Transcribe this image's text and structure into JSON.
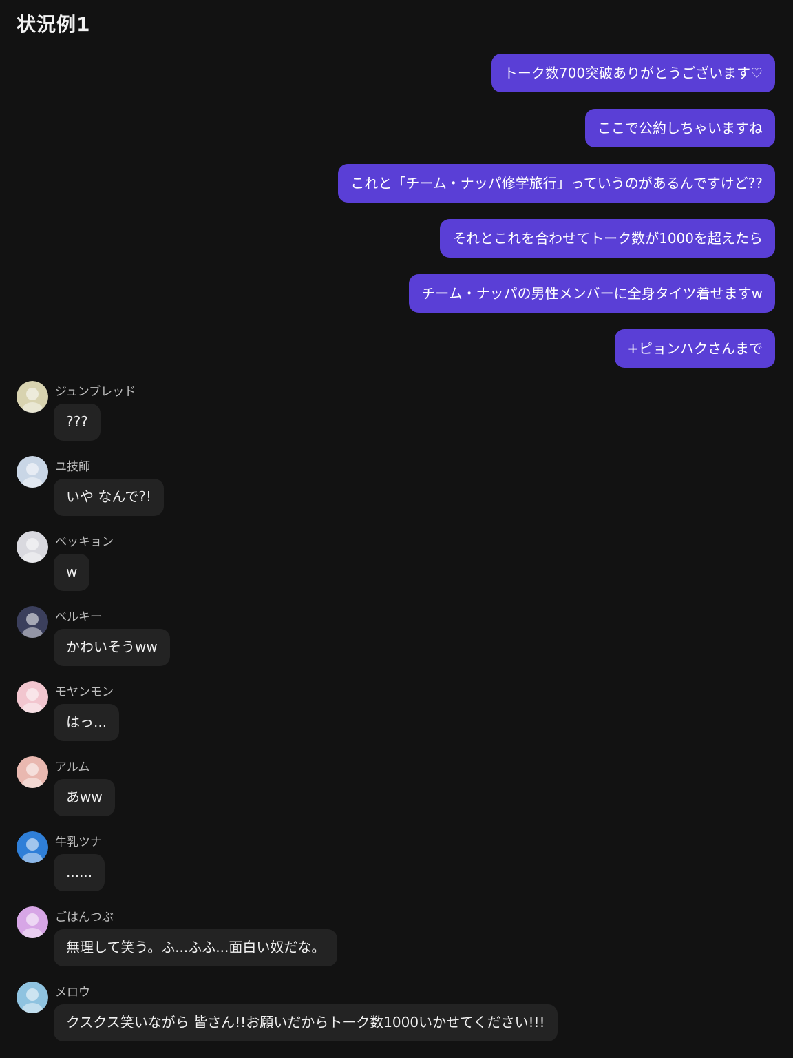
{
  "title": "状況例1",
  "colors": {
    "background": "#121212",
    "sent_bubble": "#5a3fd6",
    "received_bubble": "#232323"
  },
  "sent_messages": [
    "トーク数700突破ありがとうございます♡",
    "ここで公約しちゃいますね",
    "これと「チーム・ナッパ修学旅行」っていうのがあるんですけど??",
    "それとこれを合わせてトーク数が1000を超えたら",
    "チーム・ナッパの男性メンバーに全身タイツ着せますw",
    "+ピョンハクさんまで"
  ],
  "received_messages": [
    {
      "sender": "ジュンブレッド",
      "text": "???",
      "avatar_color": "#d8d3b0"
    },
    {
      "sender": "ユ技師",
      "text": "いや なんで?!",
      "avatar_color": "#c9d6e6"
    },
    {
      "sender": "ベッキョン",
      "text": "w",
      "avatar_color": "#d9d9df"
    },
    {
      "sender": "ベルキー",
      "text": "かわいそうww",
      "avatar_color": "#3b3f5c"
    },
    {
      "sender": "モヤンモン",
      "text": "はっ...",
      "avatar_color": "#f2c6cf"
    },
    {
      "sender": "アルム",
      "text": "あww",
      "avatar_color": "#e9b8b0"
    },
    {
      "sender": "牛乳ツナ",
      "text": "......",
      "avatar_color": "#2f7fd8"
    },
    {
      "sender": "ごはんつぶ",
      "text": "無理して笑う。ふ...ふふ...面白い奴だな。",
      "avatar_color": "#d7a6e6"
    },
    {
      "sender": "メロウ",
      "text": "クスクス笑いながら 皆さん!!お願いだからトーク数1000いかせてください!!!",
      "avatar_color": "#8fc3e0"
    }
  ]
}
